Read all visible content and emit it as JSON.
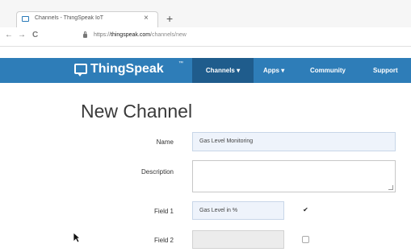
{
  "browser": {
    "tab_title": "Channels - ThingSpeak IoT",
    "tab_close": "×",
    "new_tab": "+",
    "nav_back": "←",
    "nav_forward": "→",
    "nav_reload": "C",
    "url_scheme": "https://",
    "url_host": "thingspeak.com",
    "url_path": "/channels/new"
  },
  "navbar": {
    "brand": "ThingSpeak",
    "brand_tm": "™",
    "items": [
      {
        "label": "Channels ▾",
        "active": true
      },
      {
        "label": "Apps ▾",
        "active": false
      },
      {
        "label": "Community",
        "active": false
      },
      {
        "label": "Support",
        "active": false
      }
    ],
    "bg_color": "#2e7db8",
    "active_color": "#1f5c8c"
  },
  "page": {
    "title": "New Channel"
  },
  "form": {
    "name_label": "Name",
    "name_value": "Gas Level Monitoring",
    "description_label": "Description",
    "description_value": "",
    "field1_label": "Field 1",
    "field1_value": "Gas Level in %",
    "field1_checked": true,
    "field1_check_glyph": "✔",
    "field2_label": "Field 2",
    "field2_value": "",
    "field2_checked": false
  }
}
